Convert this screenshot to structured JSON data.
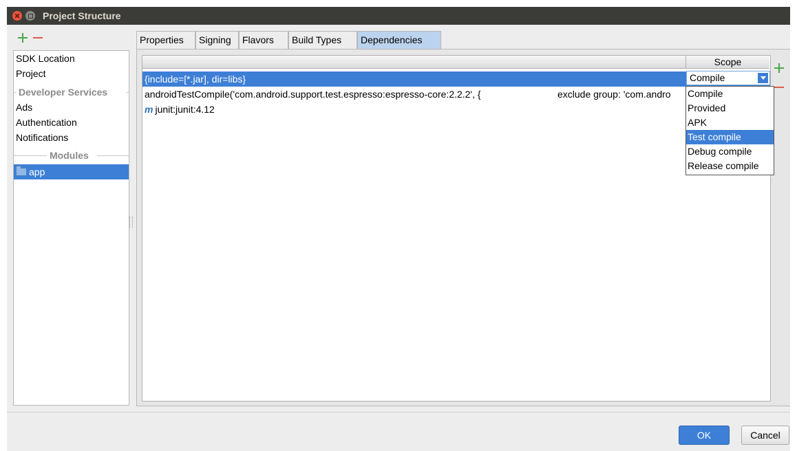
{
  "window": {
    "title": "Project Structure"
  },
  "sidebar": {
    "items": [
      {
        "label": "SDK Location"
      },
      {
        "label": "Project"
      }
    ],
    "developer_services_header": "Developer Services",
    "developer_services": [
      {
        "label": "Ads"
      },
      {
        "label": "Authentication"
      },
      {
        "label": "Notifications"
      }
    ],
    "modules_header": "Modules",
    "modules": [
      {
        "label": "app",
        "selected": true
      }
    ]
  },
  "tabs": [
    {
      "label": "Properties"
    },
    {
      "label": "Signing"
    },
    {
      "label": "Flavors"
    },
    {
      "label": "Build Types"
    },
    {
      "label": "Dependencies",
      "active": true
    }
  ],
  "dependencies": {
    "scope_header": "Scope",
    "rows": [
      {
        "text": "{include=[*.jar], dir=libs}",
        "scope": "Compile",
        "selected": true
      },
      {
        "text": "androidTestCompile('com.android.support.test.espresso:espresso-core:2.2.2', {",
        "extra": "exclude group: 'com.andro"
      },
      {
        "icon": "m",
        "text": "junit:junit:4.12"
      }
    ],
    "scope_options": [
      "Compile",
      "Provided",
      "APK",
      "Test compile",
      "Debug compile",
      "Release compile"
    ],
    "highlighted_option": "Test compile"
  },
  "footer": {
    "ok_label": "OK",
    "cancel_label": "Cancel"
  },
  "colors": {
    "selection": "#3d7fd6",
    "add": "#4aa64a",
    "remove": "#e05a4a",
    "titlebar": "#3b3b37"
  }
}
